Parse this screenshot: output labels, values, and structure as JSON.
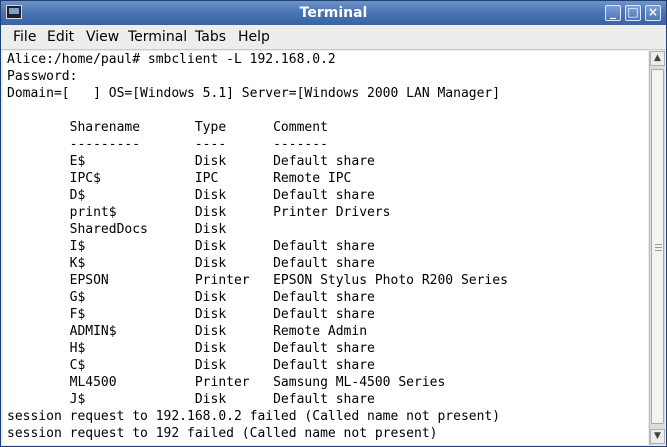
{
  "window": {
    "title": "Terminal"
  },
  "menu": {
    "items": [
      "File",
      "Edit",
      "View",
      "Terminal",
      "Tabs",
      "Help"
    ]
  },
  "window_buttons": {
    "minimize": "_",
    "maximize": "□",
    "close": "×"
  },
  "terminal": {
    "lines": [
      "Alice:/home/paul# smbclient -L 192.168.0.2",
      "Password:",
      "Domain=[   ] OS=[Windows 5.1] Server=[Windows 2000 LAN Manager]",
      "",
      "        Sharename       Type      Comment",
      "        ---------       ----      -------",
      "        E$              Disk      Default share",
      "        IPC$            IPC       Remote IPC",
      "        D$              Disk      Default share",
      "        print$          Disk      Printer Drivers",
      "        SharedDocs      Disk",
      "        I$              Disk      Default share",
      "        K$              Disk      Default share",
      "        EPSON           Printer   EPSON Stylus Photo R200 Series",
      "        G$              Disk      Default share",
      "        F$              Disk      Default share",
      "        ADMIN$          Disk      Remote Admin",
      "        H$              Disk      Default share",
      "        C$              Disk      Default share",
      "        ML4500          Printer   Samsung ML-4500 Series",
      "        J$              Disk      Default share",
      "session request to 192.168.0.2 failed (Called name not present)",
      "session request to 192 failed (Called name not present)"
    ]
  },
  "scrollbar": {
    "up_arrow": "▲",
    "down_arrow": "▼"
  }
}
